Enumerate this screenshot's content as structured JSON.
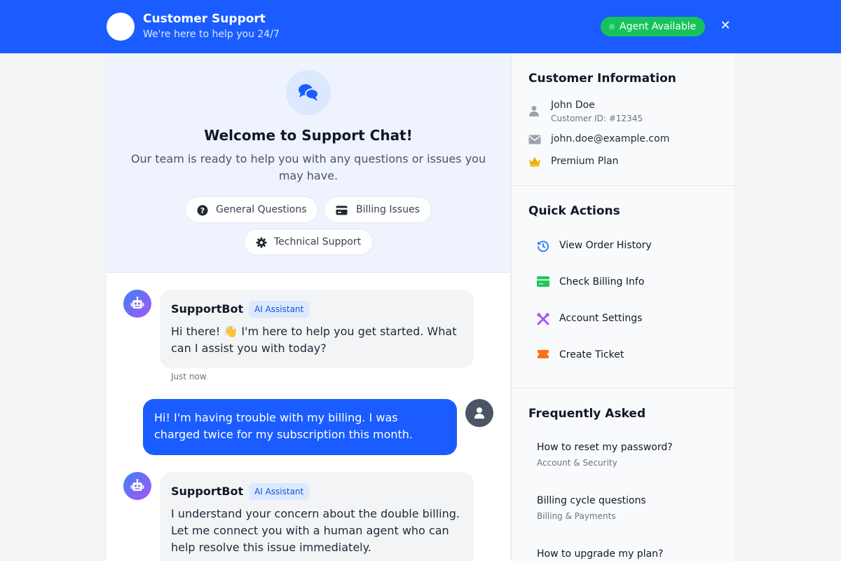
{
  "header": {
    "title": "Customer Support",
    "subtitle": "We're here to help you 24/7",
    "status": "Agent Available",
    "close_label": "✕"
  },
  "welcome": {
    "title": "Welcome to Support Chat!",
    "text": "Our team is ready to help you with any questions or issues you may have.",
    "topics": [
      {
        "label": "General Questions",
        "icon": "question-circle-icon"
      },
      {
        "label": "Billing Issues",
        "icon": "credit-card-icon"
      },
      {
        "label": "Technical Support",
        "icon": "gear-icon"
      }
    ]
  },
  "messages": [
    {
      "sender": "SupportBot",
      "badge": "AI Assistant",
      "text": "Hi there! 👋 I'm here to help you get started. What can I assist you with today?",
      "time": "Just now"
    },
    {
      "sender": "user",
      "text": "Hi! I'm having trouble with my billing. I was charged twice for my subscription this month."
    },
    {
      "sender": "SupportBot",
      "badge": "AI Assistant",
      "text": "I understand your concern about the double billing. Let me connect you with a human agent who can help resolve this issue immediately."
    }
  ],
  "customer": {
    "section_title": "Customer Information",
    "name": "John Doe",
    "id": "Customer ID: #12345",
    "email": "john.doe@example.com",
    "plan": "Premium Plan"
  },
  "quick_actions": {
    "title": "Quick Actions",
    "items": [
      {
        "label": "View Order History",
        "icon": "history-icon",
        "color": "#3b82f6"
      },
      {
        "label": "Check Billing Info",
        "icon": "credit-card-icon",
        "color": "#22c55e"
      },
      {
        "label": "Account Settings",
        "icon": "tools-icon",
        "color": "#a855f7"
      },
      {
        "label": "Create Ticket",
        "icon": "ticket-icon",
        "color": "#f97316"
      }
    ]
  },
  "faq": {
    "title": "Frequently Asked",
    "items": [
      {
        "question": "How to reset my password?",
        "category": "Account & Security"
      },
      {
        "question": "Billing cycle questions",
        "category": "Billing & Payments"
      },
      {
        "question": "How to upgrade my plan?",
        "category": ""
      }
    ]
  },
  "colors": {
    "primary": "#1a5cff",
    "available": "#16c35b",
    "bot_gradient_start": "#3b82f6",
    "bot_gradient_end": "#a855f7"
  }
}
